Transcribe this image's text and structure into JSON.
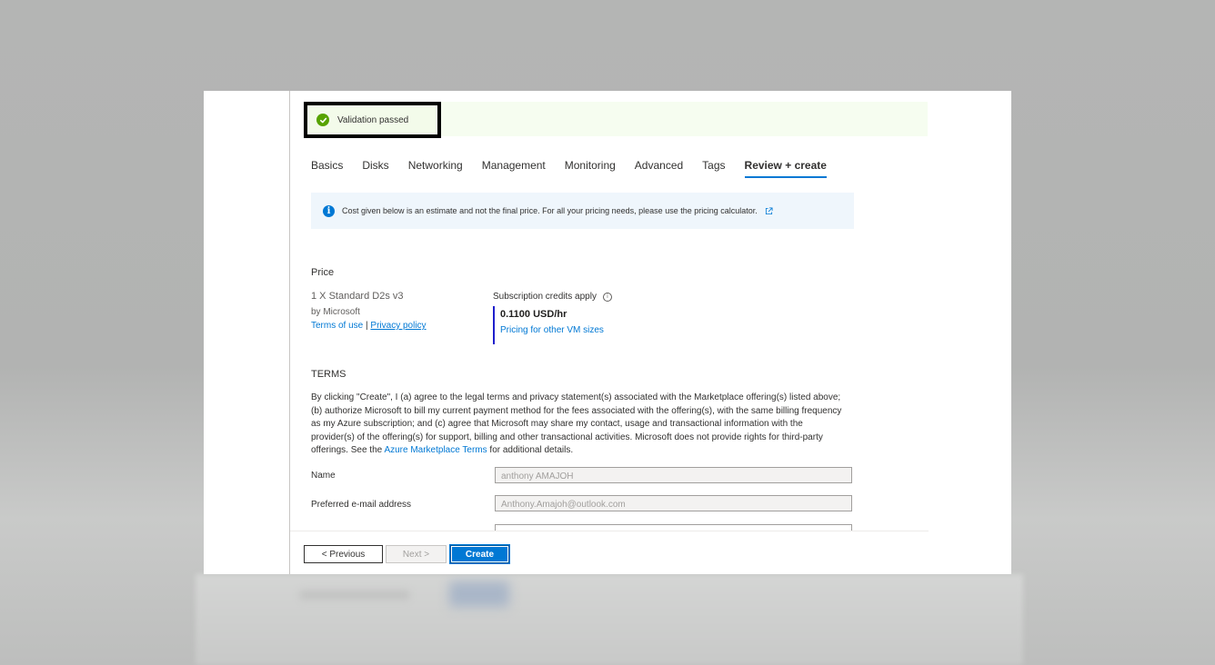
{
  "validation": {
    "message": "Validation passed",
    "status_color": "#57a300"
  },
  "tabs": [
    {
      "label": "Basics"
    },
    {
      "label": "Disks"
    },
    {
      "label": "Networking"
    },
    {
      "label": "Management"
    },
    {
      "label": "Monitoring"
    },
    {
      "label": "Advanced"
    },
    {
      "label": "Tags"
    },
    {
      "label": "Review + create",
      "active": true
    }
  ],
  "info_banner": {
    "text": "Cost given below is an estimate and not the final price. For all your pricing needs, please use the pricing calculator.",
    "icon": "info-icon"
  },
  "price": {
    "section_title": "Price",
    "product_name": "1 X Standard D2s v3",
    "publisher": "by Microsoft",
    "terms_of_use": "Terms of use",
    "separator": "|",
    "privacy_policy": "Privacy policy",
    "credits_label": "Subscription credits apply",
    "hourly_price": "0.1100 USD/hr",
    "other_sizes_link": "Pricing for other VM sizes"
  },
  "terms": {
    "section_title": "TERMS",
    "text_before_link": "By clicking \"Create\", I (a) agree to the legal terms and privacy statement(s) associated with the Marketplace offering(s) listed above; (b) authorize Microsoft to bill my current payment method for the fees associated with the offering(s), with the same billing frequency as my Azure subscription; and (c) agree that Microsoft may share my contact, usage and transactional information with the provider(s) of the offering(s) for support, billing and other transactional activities. Microsoft does not provide rights for third-party offerings. See the ",
    "link_text": "Azure Marketplace Terms",
    "text_after_link": " for additional details."
  },
  "contact": {
    "name_label": "Name",
    "name_value": "anthony AMAJOH",
    "email_label": "Preferred e-mail address",
    "email_value": "Anthony.Amajoh@outlook.com"
  },
  "footer": {
    "previous_label": "< Previous",
    "next_label": "Next >",
    "create_label": "Create"
  },
  "colors": {
    "accent": "#0078d4",
    "success": "#57a300",
    "info_background": "#eff6fc",
    "validation_background": "#f6fdf0"
  }
}
